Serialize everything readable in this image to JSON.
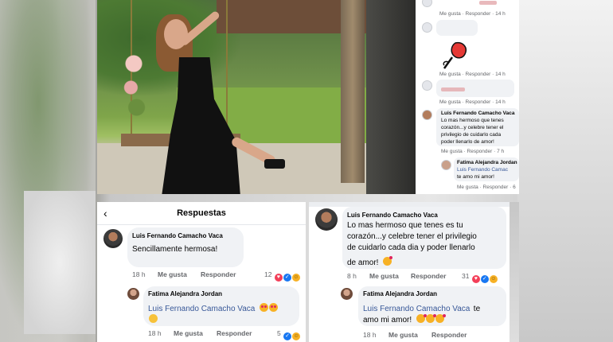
{
  "thread": {
    "rows": [
      {
        "meta": "Me gusta · Responder · 14 h"
      },
      {
        "meta": "Me gusta · Responder · 14 h"
      },
      {
        "meta": "Me gusta · Responder · 14 h"
      },
      {
        "meta": "Me gusta · Responder · 14 h"
      }
    ],
    "comment": {
      "author": "Luis Fernando Camacho Vaca",
      "lines": [
        "Lo mas hermoso que tenes",
        "corazón...y celebre tener el",
        "privilegio de cuidarlo cada",
        "poder llenarlo de amor!"
      ],
      "meta": "Me gusta · Responder · 7 h"
    },
    "reply": {
      "author": "Fatima Alejandra Jordan",
      "mention": "Luis Fernando Camac",
      "text": "te amo mi amor!",
      "meta": "Me gusta · Responder · 6"
    }
  },
  "respuestas": {
    "title": "Respuestas",
    "comment": {
      "author": "Luis Fernando Camacho Vaca",
      "text": "Sencillamente hermosa!",
      "time": "18 h",
      "like": "Me gusta",
      "reply": "Responder",
      "reactions": "12"
    },
    "reply": {
      "author": "Fatima Alejandra Jordan",
      "mention": "Luis Fernando Camacho Vaca",
      "time": "18 h",
      "like": "Me gusta",
      "reply": "Responder",
      "reactions": "5"
    }
  },
  "zoomed": {
    "comment": {
      "author": "Luis Fernando Camacho Vaca",
      "lines": [
        "Lo mas hermoso que tenes es tu",
        "corazón...y celebre tener el privilegio",
        "de cuidarlo cada dia y poder llenarlo",
        "de amor!"
      ],
      "time": "8 h",
      "like": "Me gusta",
      "reply": "Responder",
      "reactions": "31"
    },
    "reply": {
      "author": "Fatima Alejandra Jordan",
      "mention": "Luis Fernando Camacho Vaca",
      "mention_suffix": "te",
      "text": "amo mi amor!",
      "time": "18 h",
      "like": "Me gusta",
      "reply": "Responder"
    }
  },
  "colors": {
    "link": "#385898",
    "bubble": "#f0f2f5",
    "meta": "#65676b",
    "love": "#f33e58",
    "like": "#1877f2"
  },
  "icons": [
    "back-arrow-icon",
    "rose-icon",
    "love-reaction-icon",
    "like-reaction-icon",
    "haha-reaction-icon",
    "heart-eyes-emoji-icon",
    "kiss-emoji-icon",
    "smile-emoji-icon",
    "smiling-hearts-emoji-icon"
  ]
}
